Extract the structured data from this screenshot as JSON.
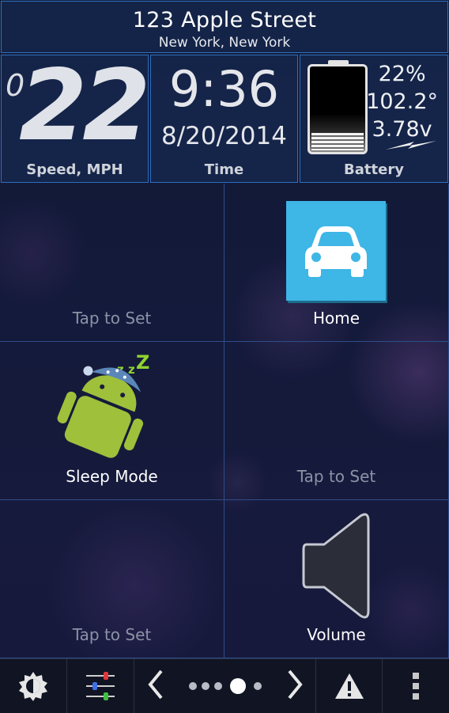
{
  "header": {
    "street": "123 Apple Street",
    "city": "New York, New York"
  },
  "speed": {
    "lead_digit": "0",
    "value": "22",
    "label": "Speed, MPH"
  },
  "time": {
    "clock": "9:36",
    "date": "8/20/2014",
    "label": "Time"
  },
  "battery": {
    "percent": "22%",
    "temperature": "102.2°",
    "voltage": "3.78v",
    "label": "Battery",
    "charging_icon": "lightning-bolt-icon"
  },
  "tiles": [
    {
      "label": "Tap to Set",
      "icon": null
    },
    {
      "label": "Home",
      "icon": "car-icon"
    },
    {
      "label": "Sleep Mode",
      "icon": "sleeping-android-icon"
    },
    {
      "label": "Tap to Set",
      "icon": null
    },
    {
      "label": "Tap to Set",
      "icon": null
    },
    {
      "label": "Volume",
      "icon": "speaker-icon"
    }
  ],
  "toolbar": {
    "icons": [
      "brightness-icon",
      "equalizer-sliders-icon",
      "chevron-left-icon",
      "page-indicator",
      "chevron-right-icon",
      "warning-icon",
      "overflow-menu-icon"
    ],
    "pages_total": 5,
    "page_current": 4
  },
  "colors": {
    "accent_border": "#2f6fc0",
    "home_icon_bg": "#3eb6e6",
    "android_green": "#9fc03a",
    "zzz_green": "#8fd330"
  }
}
